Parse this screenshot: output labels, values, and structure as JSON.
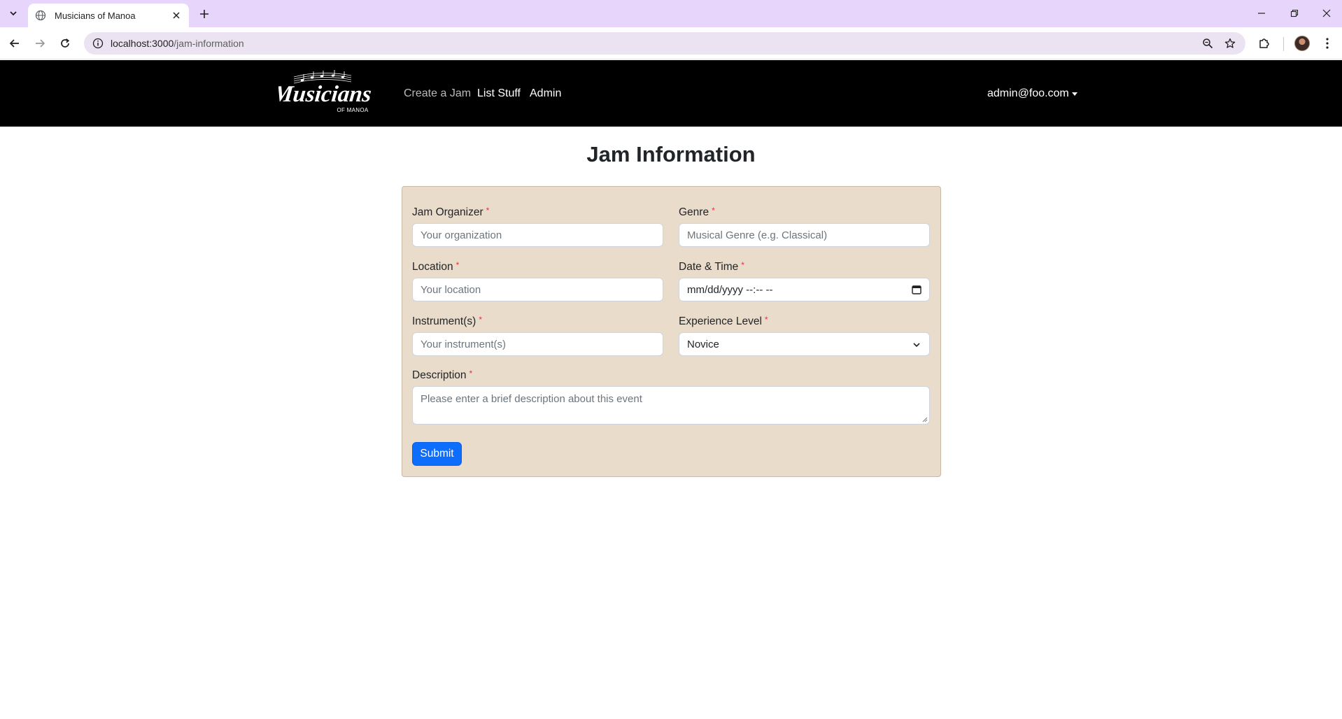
{
  "browser": {
    "tab_title": "Musicians of Manoa",
    "url_host": "localhost:3000",
    "url_path": "/jam-information"
  },
  "navbar": {
    "brand_main": "Musicians",
    "brand_sub": "OF MANOA",
    "links": [
      {
        "label": "Create a Jam",
        "state": "muted"
      },
      {
        "label": "List Stuff",
        "state": "active"
      },
      {
        "label": "Admin",
        "state": "active"
      }
    ],
    "user": "admin@foo.com"
  },
  "page": {
    "title": "Jam Information"
  },
  "form": {
    "required_marker": "*",
    "organizer": {
      "label": "Jam Organizer",
      "placeholder": "Your organization"
    },
    "genre": {
      "label": "Genre",
      "placeholder": "Musical Genre (e.g. Classical)"
    },
    "location": {
      "label": "Location",
      "placeholder": "Your location"
    },
    "datetime": {
      "label": "Date & Time",
      "placeholder": "mm/dd/yyyy --:-- --"
    },
    "instruments": {
      "label": "Instrument(s)",
      "placeholder": "Your instrument(s)"
    },
    "experience": {
      "label": "Experience Level",
      "value": "Novice"
    },
    "description": {
      "label": "Description",
      "placeholder": "Please enter a brief description about this event"
    },
    "submit_label": "Submit"
  },
  "colors": {
    "navbar_bg": "#000000",
    "card_bg": "#eadccb",
    "primary": "#0d6efd",
    "required": "#dc3545",
    "tabstrip": "#e8d5fb"
  }
}
